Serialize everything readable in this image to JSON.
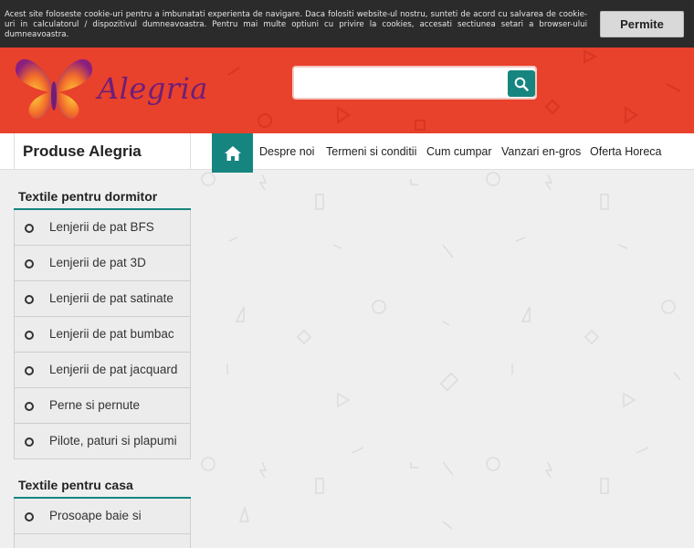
{
  "cookie_bar": {
    "text": "Acest site foloseste cookie-uri pentru a imbunatati experienta de navigare. Daca folositi website-ul nostru, sunteti de acord cu salvarea de cookie-uri in calculatorul / dispozitivul dumneavoastra. Pentru mai multe optiuni cu privire la cookies, accesati sectiunea setari a browser-ului dumneavoastra.",
    "accept_label": "Permite"
  },
  "header": {
    "logo_text": "Alegria",
    "search_placeholder": "",
    "search_icon": "search-icon"
  },
  "navbar": {
    "products_title": "Produse Alegria",
    "home_icon": "home-icon",
    "items": [
      {
        "label": "Despre noi"
      },
      {
        "label": "Termeni si conditii"
      },
      {
        "label": "Cum cumpar"
      },
      {
        "label": "Vanzari en-gros"
      },
      {
        "label": "Oferta Horeca"
      }
    ]
  },
  "sidebar": {
    "categories": [
      {
        "title": "Textile pentru dormitor",
        "items": [
          {
            "label": "Lenjerii de pat BFS"
          },
          {
            "label": "Lenjerii de pat 3D"
          },
          {
            "label": "Lenjerii de pat satinate"
          },
          {
            "label": "Lenjerii de pat bumbac"
          },
          {
            "label": "Lenjerii de pat jacquard"
          },
          {
            "label": "Perne si pernute"
          },
          {
            "label": "Pilote, paturi si plapumi"
          }
        ]
      },
      {
        "title": "Textile pentru casa",
        "items": [
          {
            "label": "Prosoape baie si"
          }
        ]
      }
    ]
  },
  "colors": {
    "header_red": "#e8412c",
    "accent_teal": "#16857f",
    "cookie_bg": "#2b2b2b"
  }
}
